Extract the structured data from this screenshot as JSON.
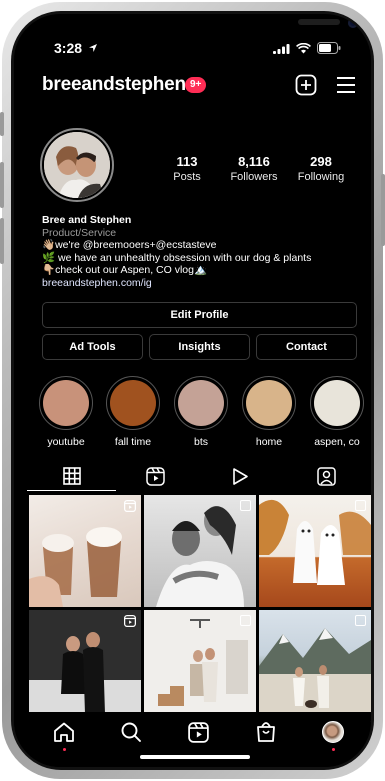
{
  "status_bar": {
    "time": "3:28"
  },
  "header": {
    "username": "breeandstephen",
    "notification_badge": "9+"
  },
  "profile": {
    "stats": [
      {
        "value": "113",
        "label": "Posts"
      },
      {
        "value": "8,116",
        "label": "Followers"
      },
      {
        "value": "298",
        "label": "Following"
      }
    ],
    "bio": {
      "name": "Bree and Stephen",
      "category": "Product/Service",
      "line1": "👋🏼we're @breemooers+@ecstasteve",
      "line2": "🌿 we have an unhealthy obsession with our dog & plants",
      "line3": "👇🏼check out our Aspen, CO vlog🏔️",
      "link": "breeandstephen.com/ig"
    }
  },
  "buttons": {
    "edit_profile": "Edit Profile",
    "ad_tools": "Ad Tools",
    "insights": "Insights",
    "contact": "Contact"
  },
  "highlights": [
    {
      "label": "youtube",
      "color": "#c8927a"
    },
    {
      "label": "fall time",
      "color": "#a0521f"
    },
    {
      "label": "bts",
      "color": "#c4a296"
    },
    {
      "label": "home",
      "color": "#d8b48a"
    },
    {
      "label": "aspen, co",
      "color": "#e8e4da"
    }
  ],
  "tabs": [
    "grid-icon",
    "reels-icon",
    "video-icon",
    "tagged-icon"
  ],
  "grid_posts": [
    {
      "alt": "hot cocoa mugs",
      "type": "reel"
    },
    {
      "alt": "couple portrait black and white",
      "type": "multi"
    },
    {
      "alt": "ghost costumes in autumn leaves",
      "type": "multi"
    },
    {
      "alt": "couple in black outfits",
      "type": "reel"
    },
    {
      "alt": "couple in white room",
      "type": "multi"
    },
    {
      "alt": "couple in mountains with dog",
      "type": "multi"
    }
  ],
  "bottom_nav": [
    "home-icon",
    "search-icon",
    "reels-icon",
    "shop-icon",
    "profile-avatar"
  ],
  "colors": {
    "accent": "#ff2d55",
    "background": "#000000"
  }
}
